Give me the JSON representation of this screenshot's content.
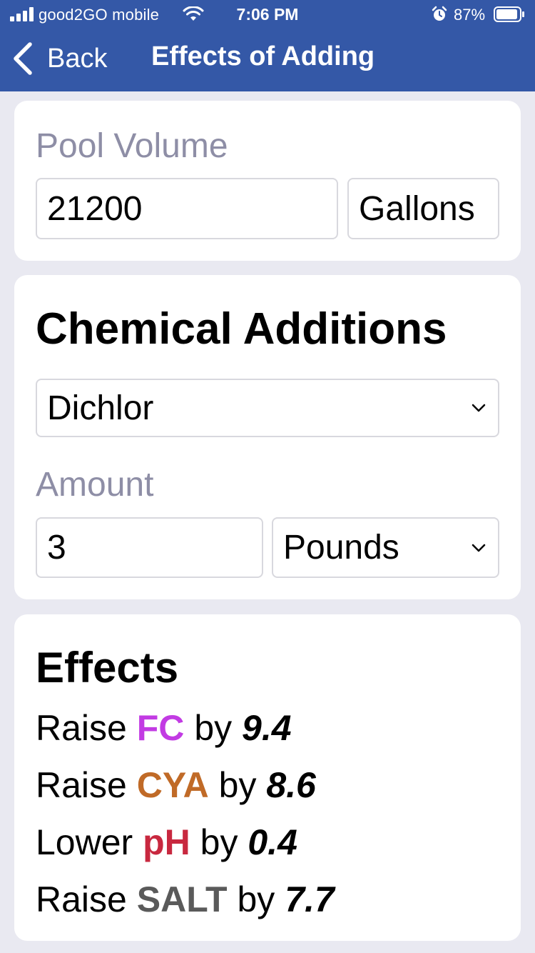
{
  "status_bar": {
    "carrier": "good2GO mobile",
    "time": "7:06 PM",
    "battery_percent": "87%",
    "icons": [
      "signal-icon",
      "wifi-icon",
      "alarm-icon",
      "battery-icon"
    ]
  },
  "nav": {
    "back_label": "Back",
    "title": "Effects of Adding"
  },
  "pool_volume": {
    "label": "Pool Volume",
    "value": "21200",
    "unit": "Gallons"
  },
  "chemical_additions": {
    "title": "Chemical Additions",
    "chemical": "Dichlor",
    "amount_label": "Amount",
    "amount_value": "3",
    "amount_unit": "Pounds"
  },
  "effects": {
    "title": "Effects",
    "items": [
      {
        "verb": "Raise",
        "chem": "FC",
        "by": "by",
        "value": "9.4",
        "color": "#c23be3"
      },
      {
        "verb": "Raise",
        "chem": "CYA",
        "by": "by",
        "value": "8.6",
        "color": "#c06a27"
      },
      {
        "verb": "Lower",
        "chem": "pH",
        "by": "by",
        "value": "0.4",
        "color": "#c8283f"
      },
      {
        "verb": "Raise",
        "chem": "SALT",
        "by": "by",
        "value": "7.7",
        "color": "#5a5a5a"
      }
    ]
  },
  "colors": {
    "header": "#3458a7",
    "background": "#e9e9f1",
    "muted_label": "#8e8ea6"
  }
}
